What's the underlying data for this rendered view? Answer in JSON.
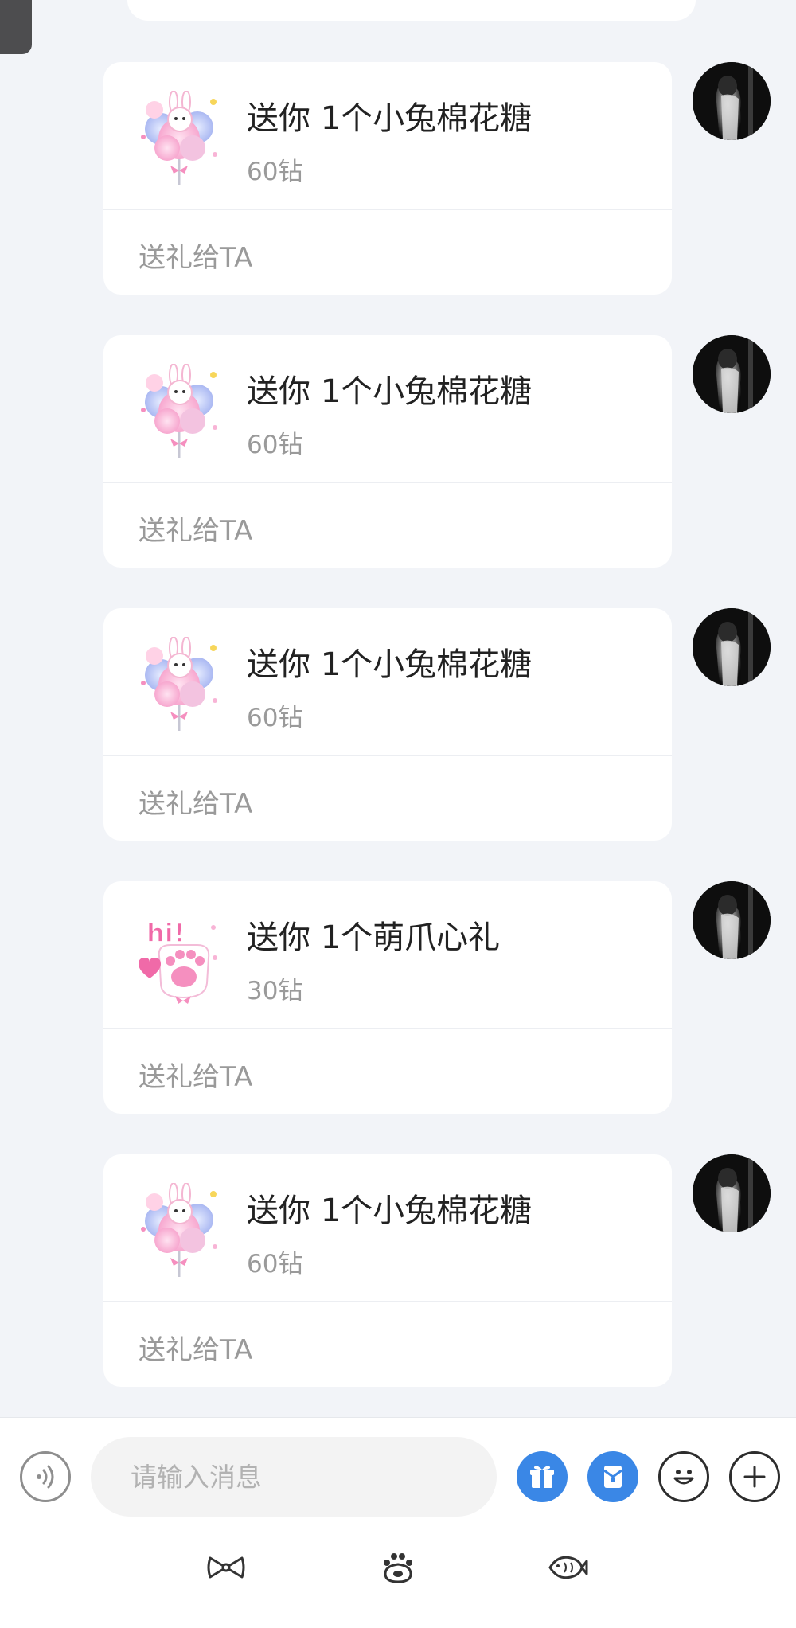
{
  "messages": [
    {
      "title": "送你 1个小兔棉花糖",
      "price": "60钻",
      "action": "送礼给TA",
      "gift_icon": "bunny-cotton-candy-icon"
    },
    {
      "title": "送你 1个小兔棉花糖",
      "price": "60钻",
      "action": "送礼给TA",
      "gift_icon": "bunny-cotton-candy-icon"
    },
    {
      "title": "送你 1个小兔棉花糖",
      "price": "60钻",
      "action": "送礼给TA",
      "gift_icon": "bunny-cotton-candy-icon"
    },
    {
      "title": "送你 1个萌爪心礼",
      "price": "30钻",
      "action": "送礼给TA",
      "gift_icon": "paw-heart-icon"
    },
    {
      "title": "送你 1个小兔棉花糖",
      "price": "60钻",
      "action": "送礼给TA",
      "gift_icon": "bunny-cotton-candy-icon"
    }
  ],
  "paw_gift_hi_text": "hi!",
  "input_bar": {
    "placeholder": "请输入消息",
    "buttons": [
      "voice-icon",
      "gift-icon",
      "red-packet-icon",
      "emoji-icon",
      "plus-icon"
    ]
  },
  "bottom_tabs": [
    "bow-icon",
    "paw-icon",
    "fish-icon"
  ],
  "colors": {
    "accent": "#3a87e6",
    "background": "#f2f4f8",
    "card": "#ffffff",
    "muted_text": "#9a9a9a"
  }
}
